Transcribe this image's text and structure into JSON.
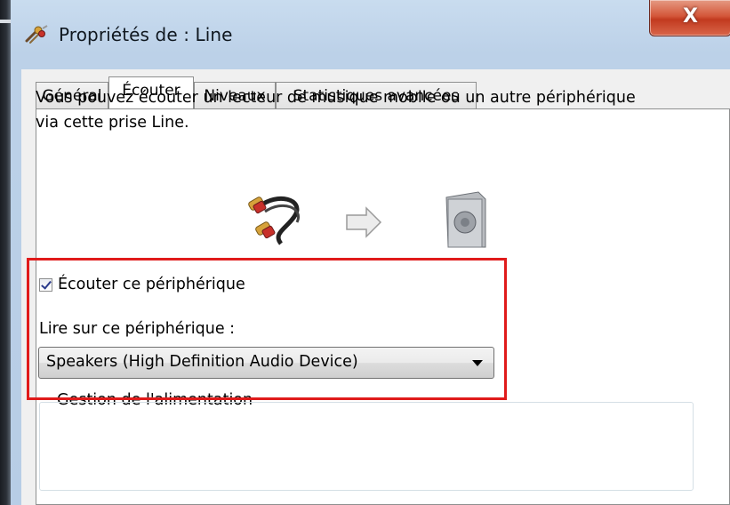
{
  "window": {
    "title": "Propriétés de : Line",
    "close_label": "X"
  },
  "tabs": [
    {
      "label": "Général",
      "active": false
    },
    {
      "label": "Écouter",
      "active": true
    },
    {
      "label": "Niveaux",
      "active": false
    },
    {
      "label": "Statistiques avancées",
      "active": false
    }
  ],
  "listen": {
    "description": "Vous pouvez écouter un lecteur de musique mobile ou un autre périphérique via cette prise Line.",
    "icons": [
      "rca-cable-icon",
      "arrow-right-icon",
      "speaker-icon"
    ],
    "checkbox_label": "Écouter ce périphérique",
    "checkbox_checked": true,
    "playback_label": "Lire sur ce périphérique :",
    "playback_device": "Speakers (High Definition Audio Device)",
    "highlight_color": "#e01b1b"
  },
  "power": {
    "legend": "Gestion de l'alimentation"
  }
}
